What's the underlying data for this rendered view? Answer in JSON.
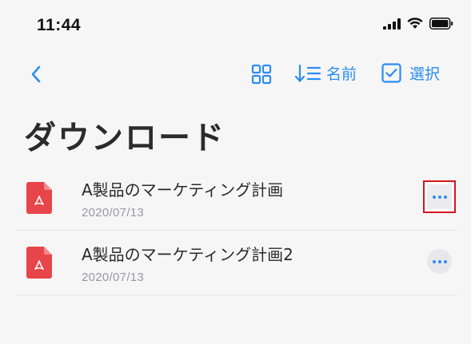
{
  "status_bar": {
    "time": "11:44",
    "icons": [
      "signal-icon",
      "wifi-icon",
      "battery-icon"
    ]
  },
  "nav": {
    "back_icon": "chevron-left-icon",
    "grid_icon": "grid-view-icon",
    "sort_icon": "sort-descending-icon",
    "sort_label": "名前",
    "select_icon": "checkbox-icon",
    "select_label": "選択"
  },
  "page": {
    "title": "ダウンロード"
  },
  "files": [
    {
      "name": "A製品のマーケティング計画",
      "date": "2020/07/13",
      "icon": "pdf-file-icon",
      "more_highlighted": true
    },
    {
      "name": "A製品のマーケティング計画2",
      "date": "2020/07/13",
      "icon": "pdf-file-icon",
      "more_highlighted": false
    }
  ],
  "colors": {
    "accent": "#2a8df0",
    "pdf_red": "#e8454a",
    "background": "#f6f6f7",
    "highlight_border": "#d9141c"
  }
}
